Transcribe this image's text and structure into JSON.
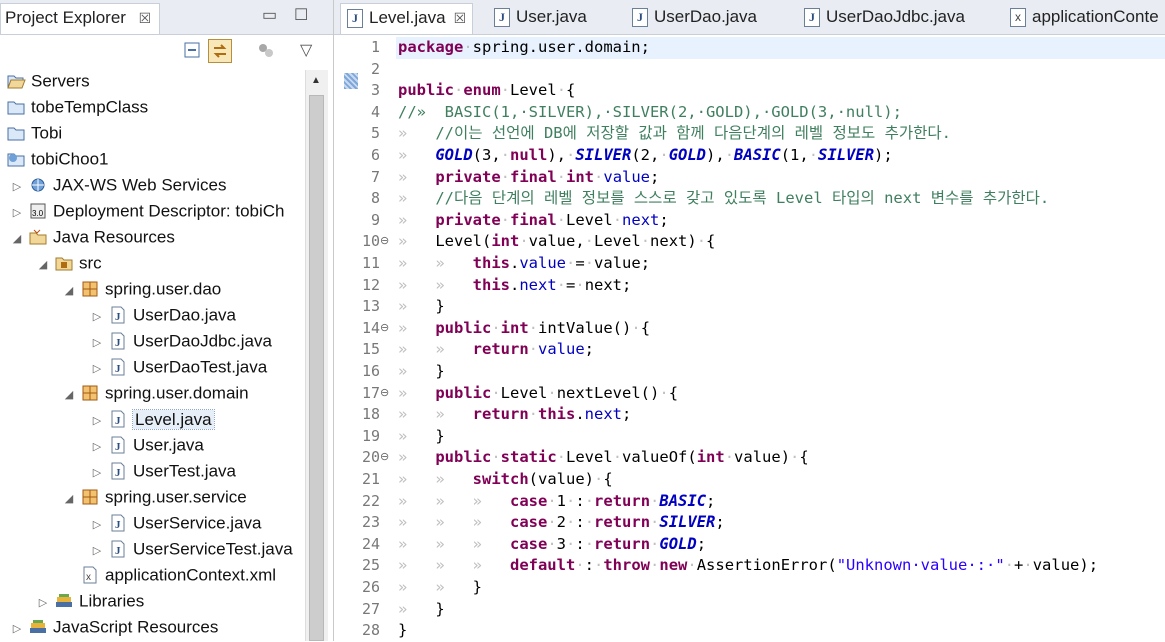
{
  "explorer": {
    "tab_label": "Project Explorer",
    "close_glyph": "☒",
    "minimize_glyph": "▭",
    "maximize_glyph": "☐",
    "menu_glyph": "▽",
    "tree": [
      {
        "label": "Servers",
        "icon": "folder-open-icon",
        "twisty": ""
      },
      {
        "label": "tobeTempClass",
        "icon": "folder-icon",
        "twisty": ""
      },
      {
        "label": "Tobi",
        "icon": "folder-icon",
        "twisty": ""
      },
      {
        "label": "tobiChoo1",
        "icon": "web-project-icon",
        "twisty": ""
      },
      {
        "label": "JAX-WS Web Services",
        "icon": "web-services-icon",
        "twisty": "▷"
      },
      {
        "label": "Deployment Descriptor: tobiCh",
        "icon": "deployment-descriptor-icon",
        "twisty": "▷"
      },
      {
        "label": "Java Resources",
        "icon": "java-resources-icon",
        "twisty": "◢"
      },
      {
        "label": "src",
        "icon": "source-folder-icon",
        "twisty": "◢"
      },
      {
        "label": "spring.user.dao",
        "icon": "package-icon",
        "twisty": "◢"
      },
      {
        "label": "UserDao.java",
        "icon": "java-file-icon",
        "twisty": "▷"
      },
      {
        "label": "UserDaoJdbc.java",
        "icon": "java-file-icon",
        "twisty": "▷"
      },
      {
        "label": "UserDaoTest.java",
        "icon": "java-file-icon",
        "twisty": "▷"
      },
      {
        "label": "spring.user.domain",
        "icon": "package-icon",
        "twisty": "◢"
      },
      {
        "label": "Level.java",
        "icon": "java-file-icon",
        "twisty": "▷"
      },
      {
        "label": "User.java",
        "icon": "java-file-icon",
        "twisty": "▷"
      },
      {
        "label": "UserTest.java",
        "icon": "java-file-icon",
        "twisty": "▷"
      },
      {
        "label": "spring.user.service",
        "icon": "package-icon",
        "twisty": "◢"
      },
      {
        "label": "UserService.java",
        "icon": "java-file-icon",
        "twisty": "▷"
      },
      {
        "label": "UserServiceTest.java",
        "icon": "java-file-icon",
        "twisty": "▷"
      },
      {
        "label": "applicationContext.xml",
        "icon": "xml-file-icon",
        "twisty": ""
      },
      {
        "label": "Libraries",
        "icon": "libraries-icon",
        "twisty": "▷"
      },
      {
        "label": "JavaScript Resources",
        "icon": "libraries-icon",
        "twisty": "▷"
      }
    ]
  },
  "editor": {
    "tabs": [
      {
        "label": "Level.java",
        "icon": "java-file-icon",
        "active": true
      },
      {
        "label": "User.java",
        "icon": "java-file-icon",
        "active": false
      },
      {
        "label": "UserDao.java",
        "icon": "java-file-icon",
        "active": false
      },
      {
        "label": "UserDaoJdbc.java",
        "icon": "java-file-icon",
        "active": false
      },
      {
        "label": "applicationConte",
        "icon": "xml-file-icon",
        "active": false
      }
    ],
    "close_glyph": "☒",
    "fold_glyph": "⊖",
    "lines": [
      {
        "n": "1",
        "fold": "",
        "tokens": [
          [
            "kw",
            "package"
          ],
          [
            "ws",
            "·"
          ],
          [
            "",
            "spring.user.domain;"
          ]
        ]
      },
      {
        "n": "2",
        "fold": "",
        "tokens": []
      },
      {
        "n": "3",
        "fold": "",
        "tokens": [
          [
            "kw",
            "public"
          ],
          [
            "ws",
            "·"
          ],
          [
            "kw",
            "enum"
          ],
          [
            "ws",
            "·"
          ],
          [
            "",
            "Level"
          ],
          [
            "ws",
            "·"
          ],
          [
            "",
            "{"
          ]
        ]
      },
      {
        "n": "4",
        "fold": "",
        "tokens": [
          [
            "cm",
            "//»  BASIC(1,·SILVER),·SILVER(2,·GOLD),·GOLD(3,·null);"
          ]
        ]
      },
      {
        "n": "5",
        "fold": "",
        "tokens": [
          [
            "ws",
            "»   "
          ],
          [
            "cm",
            "//이는 선언에 DB에 저장할 값과 함께 다음단계의 레벨 정보도 추가한다."
          ]
        ]
      },
      {
        "n": "6",
        "fold": "",
        "tokens": [
          [
            "ws",
            "»   "
          ],
          [
            "en",
            "GOLD"
          ],
          [
            "",
            "(3,"
          ],
          [
            "ws",
            "·"
          ],
          [
            "kw",
            "null"
          ],
          [
            "",
            "),"
          ],
          [
            "ws",
            "·"
          ],
          [
            "en",
            "SILVER"
          ],
          [
            "",
            "(2,"
          ],
          [
            "ws",
            "·"
          ],
          [
            "en",
            "GOLD"
          ],
          [
            "",
            "),"
          ],
          [
            "ws",
            "·"
          ],
          [
            "en",
            "BASIC"
          ],
          [
            "",
            "(1,"
          ],
          [
            "ws",
            "·"
          ],
          [
            "en",
            "SILVER"
          ],
          [
            "",
            ");"
          ]
        ]
      },
      {
        "n": "7",
        "fold": "",
        "tokens": [
          [
            "ws",
            "»   "
          ],
          [
            "kw",
            "private"
          ],
          [
            "ws",
            "·"
          ],
          [
            "kw",
            "final"
          ],
          [
            "ws",
            "·"
          ],
          [
            "kw",
            "int"
          ],
          [
            "ws",
            "·"
          ],
          [
            "fd",
            "value"
          ],
          [
            "",
            ";"
          ]
        ]
      },
      {
        "n": "8",
        "fold": "",
        "tokens": [
          [
            "ws",
            "»   "
          ],
          [
            "cm",
            "//다음 단계의 레벨 정보를 스스로 갖고 있도록 Level 타입의 next 변수를 추가한다."
          ]
        ]
      },
      {
        "n": "9",
        "fold": "",
        "tokens": [
          [
            "ws",
            "»   "
          ],
          [
            "kw",
            "private"
          ],
          [
            "ws",
            "·"
          ],
          [
            "kw",
            "final"
          ],
          [
            "ws",
            "·"
          ],
          [
            "",
            "Level"
          ],
          [
            "ws",
            "·"
          ],
          [
            "fd",
            "next"
          ],
          [
            "",
            ";"
          ]
        ]
      },
      {
        "n": "10",
        "fold": "⊖",
        "tokens": [
          [
            "ws",
            "»   "
          ],
          [
            "",
            "Level("
          ],
          [
            "kw",
            "int"
          ],
          [
            "ws",
            "·"
          ],
          [
            "",
            "value,"
          ],
          [
            "ws",
            "·"
          ],
          [
            "",
            "Level"
          ],
          [
            "ws",
            "·"
          ],
          [
            "",
            "next)"
          ],
          [
            "ws",
            "·"
          ],
          [
            "",
            "{"
          ]
        ]
      },
      {
        "n": "11",
        "fold": "",
        "tokens": [
          [
            "ws",
            "»   »   "
          ],
          [
            "kw",
            "this"
          ],
          [
            "",
            ".",
            ""
          ],
          [
            "fd",
            "value"
          ],
          [
            "ws",
            "·"
          ],
          [
            "",
            "="
          ],
          [
            "ws",
            "·"
          ],
          [
            "",
            "value;"
          ]
        ]
      },
      {
        "n": "12",
        "fold": "",
        "tokens": [
          [
            "ws",
            "»   »   "
          ],
          [
            "kw",
            "this"
          ],
          [
            "",
            "."
          ],
          [
            "fd",
            "next"
          ],
          [
            "ws",
            "·"
          ],
          [
            "",
            "="
          ],
          [
            "ws",
            "·"
          ],
          [
            "",
            "next;"
          ]
        ]
      },
      {
        "n": "13",
        "fold": "",
        "tokens": [
          [
            "ws",
            "»   "
          ],
          [
            "",
            "}"
          ]
        ]
      },
      {
        "n": "14",
        "fold": "⊖",
        "tokens": [
          [
            "ws",
            "»   "
          ],
          [
            "kw",
            "public"
          ],
          [
            "ws",
            "·"
          ],
          [
            "kw",
            "int"
          ],
          [
            "ws",
            "·"
          ],
          [
            "",
            "intValue()"
          ],
          [
            "ws",
            "·"
          ],
          [
            "",
            "{"
          ]
        ]
      },
      {
        "n": "15",
        "fold": "",
        "tokens": [
          [
            "ws",
            "»   »   "
          ],
          [
            "kw",
            "return"
          ],
          [
            "ws",
            "·"
          ],
          [
            "fd",
            "value"
          ],
          [
            "",
            ";"
          ]
        ]
      },
      {
        "n": "16",
        "fold": "",
        "tokens": [
          [
            "ws",
            "»   "
          ],
          [
            "",
            "}"
          ]
        ]
      },
      {
        "n": "17",
        "fold": "⊖",
        "tokens": [
          [
            "ws",
            "»   "
          ],
          [
            "kw",
            "public"
          ],
          [
            "ws",
            "·"
          ],
          [
            "",
            "Level"
          ],
          [
            "ws",
            "·"
          ],
          [
            "",
            "nextLevel()"
          ],
          [
            "ws",
            "·"
          ],
          [
            "",
            "{"
          ]
        ]
      },
      {
        "n": "18",
        "fold": "",
        "tokens": [
          [
            "ws",
            "»   »   "
          ],
          [
            "kw",
            "return"
          ],
          [
            "ws",
            "·"
          ],
          [
            "kw",
            "this"
          ],
          [
            "",
            "."
          ],
          [
            "fd",
            "next"
          ],
          [
            "",
            ";"
          ]
        ]
      },
      {
        "n": "19",
        "fold": "",
        "tokens": [
          [
            "ws",
            "»   "
          ],
          [
            "",
            "}"
          ]
        ]
      },
      {
        "n": "20",
        "fold": "⊖",
        "tokens": [
          [
            "ws",
            "»   "
          ],
          [
            "kw",
            "public"
          ],
          [
            "ws",
            "·"
          ],
          [
            "kw",
            "static"
          ],
          [
            "ws",
            "·"
          ],
          [
            "",
            "Level"
          ],
          [
            "ws",
            "·"
          ],
          [
            "",
            "valueOf("
          ],
          [
            "kw",
            "int"
          ],
          [
            "ws",
            "·"
          ],
          [
            "",
            "value)"
          ],
          [
            "ws",
            "·"
          ],
          [
            "",
            "{"
          ]
        ]
      },
      {
        "n": "21",
        "fold": "",
        "tokens": [
          [
            "ws",
            "»   »   "
          ],
          [
            "kw",
            "switch"
          ],
          [
            "",
            "(value)"
          ],
          [
            "ws",
            "·"
          ],
          [
            "",
            "{"
          ]
        ]
      },
      {
        "n": "22",
        "fold": "",
        "tokens": [
          [
            "ws",
            "»   »   »   "
          ],
          [
            "kw",
            "case"
          ],
          [
            "ws",
            "·"
          ],
          [
            "",
            "1"
          ],
          [
            "ws",
            "·"
          ],
          [
            "",
            ":"
          ],
          [
            "ws",
            "·"
          ],
          [
            "kw",
            "return"
          ],
          [
            "ws",
            "·"
          ],
          [
            "en",
            "BASIC"
          ],
          [
            "",
            ";"
          ]
        ]
      },
      {
        "n": "23",
        "fold": "",
        "tokens": [
          [
            "ws",
            "»   »   »   "
          ],
          [
            "kw",
            "case"
          ],
          [
            "ws",
            "·"
          ],
          [
            "",
            "2"
          ],
          [
            "ws",
            "·"
          ],
          [
            "",
            ":"
          ],
          [
            "ws",
            "·"
          ],
          [
            "kw",
            "return"
          ],
          [
            "ws",
            "·"
          ],
          [
            "en",
            "SILVER"
          ],
          [
            "",
            ";"
          ]
        ]
      },
      {
        "n": "24",
        "fold": "",
        "tokens": [
          [
            "ws",
            "»   »   »   "
          ],
          [
            "kw",
            "case"
          ],
          [
            "ws",
            "·"
          ],
          [
            "",
            "3"
          ],
          [
            "ws",
            "·"
          ],
          [
            "",
            ":"
          ],
          [
            "ws",
            "·"
          ],
          [
            "kw",
            "return"
          ],
          [
            "ws",
            "·"
          ],
          [
            "en",
            "GOLD"
          ],
          [
            "",
            ";"
          ]
        ]
      },
      {
        "n": "25",
        "fold": "",
        "tokens": [
          [
            "ws",
            "»   »   »   "
          ],
          [
            "kw",
            "default"
          ],
          [
            "ws",
            "·"
          ],
          [
            "",
            ":"
          ],
          [
            "ws",
            "·"
          ],
          [
            "kw",
            "throw"
          ],
          [
            "ws",
            "·"
          ],
          [
            "kw",
            "new"
          ],
          [
            "ws",
            "·"
          ],
          [
            "",
            "AssertionError("
          ],
          [
            "st",
            "\"Unknown·value·:·\""
          ],
          [
            "ws",
            "·"
          ],
          [
            "",
            "+"
          ],
          [
            "ws",
            "·"
          ],
          [
            "",
            "value);"
          ]
        ]
      },
      {
        "n": "26",
        "fold": "",
        "tokens": [
          [
            "ws",
            "»   »   "
          ],
          [
            "",
            "}"
          ]
        ]
      },
      {
        "n": "27",
        "fold": "",
        "tokens": [
          [
            "ws",
            "»   "
          ],
          [
            "",
            "}"
          ]
        ]
      },
      {
        "n": "28",
        "fold": "",
        "tokens": [
          [
            "",
            "}"
          ]
        ]
      }
    ]
  },
  "colors": {
    "keyword": "#7f0055",
    "comment": "#3f7f5f",
    "string": "#2a00ff",
    "field": "#0000c0",
    "current_line": "#e8f2fe"
  }
}
